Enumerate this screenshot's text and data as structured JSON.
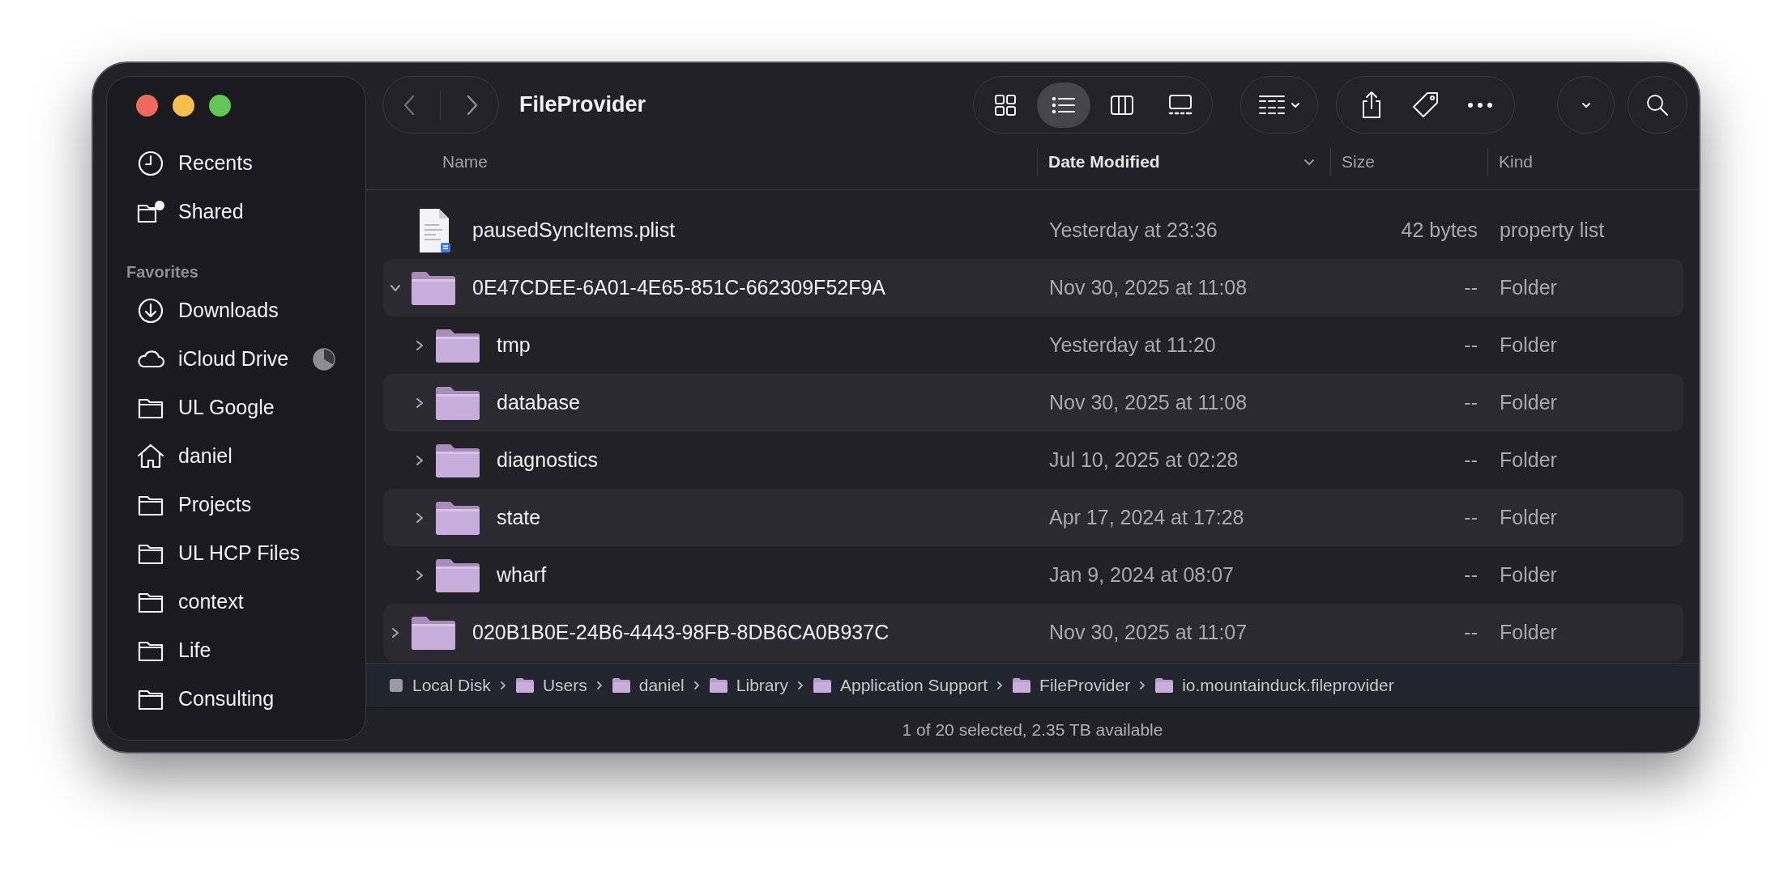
{
  "window": {
    "title": "FileProvider"
  },
  "sidebar": {
    "sections": [
      {
        "items": [
          {
            "label": "Recents",
            "kind": "clock",
            "syncing": false
          },
          {
            "label": "Shared",
            "kind": "shared",
            "syncing": false
          }
        ]
      },
      {
        "title": "Favorites",
        "items": [
          {
            "label": "Downloads",
            "kind": "download",
            "syncing": false
          },
          {
            "label": "iCloud Drive",
            "kind": "cloud",
            "syncing": true
          },
          {
            "label": "UL Google",
            "kind": "folder",
            "syncing": false
          },
          {
            "label": "daniel",
            "kind": "home",
            "syncing": false
          },
          {
            "label": "Projects",
            "kind": "folder",
            "syncing": false
          },
          {
            "label": "UL HCP Files",
            "kind": "folder",
            "syncing": false
          },
          {
            "label": "context",
            "kind": "folder",
            "syncing": false
          },
          {
            "label": "Life",
            "kind": "folder",
            "syncing": false
          },
          {
            "label": "Consulting",
            "kind": "folder",
            "syncing": false
          }
        ]
      }
    ]
  },
  "toolbar": {
    "views": [
      {
        "kind": "icons",
        "selected": false
      },
      {
        "kind": "list",
        "selected": true
      },
      {
        "kind": "columns",
        "selected": false
      },
      {
        "kind": "gallery",
        "selected": false
      }
    ]
  },
  "table": {
    "columns": [
      {
        "label": "Name",
        "sorted": false
      },
      {
        "label": "Date Modified",
        "sorted": true
      },
      {
        "label": "Size",
        "sorted": false
      },
      {
        "label": "Kind",
        "sorted": false
      }
    ],
    "rows": [
      {
        "name": "pausedSyncItems.plist",
        "kind": "file",
        "date": "Yesterday at 23:36",
        "size": "42 bytes",
        "kind_label": "property list"
      },
      {
        "name": "0E47CDEE-6A01-4E65-851C-662309F52F9A",
        "kind": "folder",
        "expanded": true,
        "date": "Nov 30, 2025 at 11:08",
        "size": "--",
        "kind_label": "Folder",
        "children": [
          {
            "name": "tmp",
            "kind": "folder",
            "expanded": false,
            "date": "Yesterday at 11:20",
            "size": "--",
            "kind_label": "Folder"
          },
          {
            "name": "database",
            "kind": "folder",
            "expanded": false,
            "date": "Nov 30, 2025 at 11:08",
            "size": "--",
            "kind_label": "Folder"
          },
          {
            "name": "diagnostics",
            "kind": "folder",
            "expanded": false,
            "date": "Jul 10, 2025 at 02:28",
            "size": "--",
            "kind_label": "Folder"
          },
          {
            "name": "state",
            "kind": "folder",
            "expanded": false,
            "date": "Apr 17, 2024 at 17:28",
            "size": "--",
            "kind_label": "Folder"
          },
          {
            "name": "wharf",
            "kind": "folder",
            "expanded": false,
            "date": "Jan 9, 2024 at 08:07",
            "size": "--",
            "kind_label": "Folder"
          }
        ]
      },
      {
        "name": "020B1B0E-24B6-4443-98FB-8DB6CA0B937C",
        "kind": "folder",
        "expanded": false,
        "date": "Nov 30, 2025 at 11:07",
        "size": "--",
        "kind_label": "Folder"
      }
    ]
  },
  "path_bar": [
    {
      "label": "Local Disk",
      "kind": "disk"
    },
    {
      "label": "Users",
      "kind": "folder"
    },
    {
      "label": "daniel",
      "kind": "folder"
    },
    {
      "label": "Library",
      "kind": "folder"
    },
    {
      "label": "Application Support",
      "kind": "folder"
    },
    {
      "label": "FileProvider",
      "kind": "folder"
    },
    {
      "label": "io.mountainduck.fileprovider",
      "kind": "folder"
    }
  ],
  "status_bar": "1 of 20 selected, 2.35 TB available"
}
